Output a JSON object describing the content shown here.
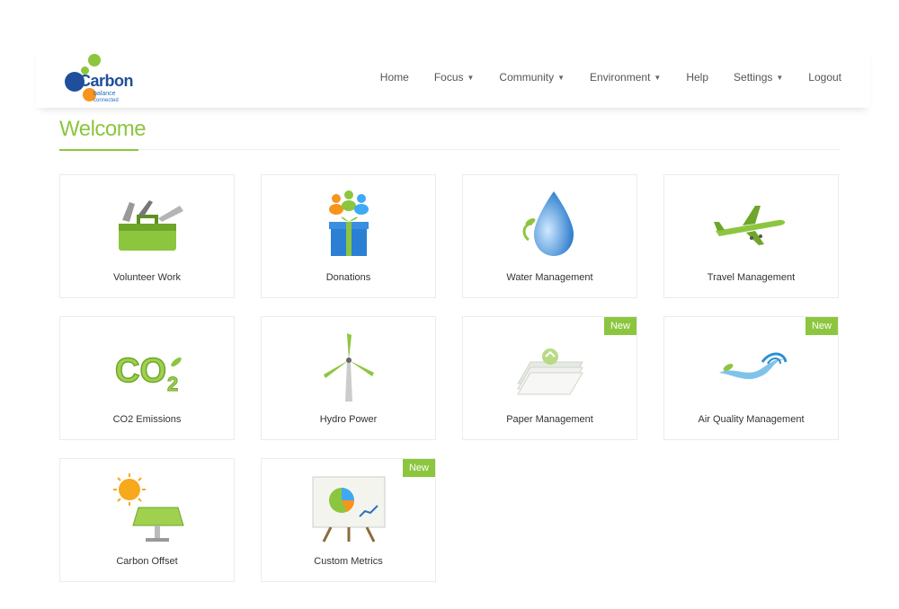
{
  "logo": {
    "word": "Carbon",
    "line1": "balance",
    "line2": "connected"
  },
  "nav": [
    {
      "label": "Home",
      "dropdown": false
    },
    {
      "label": "Focus",
      "dropdown": true
    },
    {
      "label": "Community",
      "dropdown": true
    },
    {
      "label": "Environment",
      "dropdown": true
    },
    {
      "label": "Help",
      "dropdown": false
    },
    {
      "label": "Settings",
      "dropdown": true
    },
    {
      "label": "Logout",
      "dropdown": false
    }
  ],
  "page_title": "Welcome",
  "tiles": [
    {
      "label": "Volunteer Work",
      "icon": "toolbox-icon",
      "badge": ""
    },
    {
      "label": "Donations",
      "icon": "gift-people-icon",
      "badge": ""
    },
    {
      "label": "Water Management",
      "icon": "water-drop-icon",
      "badge": ""
    },
    {
      "label": "Travel Management",
      "icon": "airplane-icon",
      "badge": ""
    },
    {
      "label": "CO2 Emissions",
      "icon": "co2-icon",
      "badge": ""
    },
    {
      "label": "Hydro Power",
      "icon": "wind-turbine-icon",
      "badge": ""
    },
    {
      "label": "Paper Management",
      "icon": "recycled-paper-icon",
      "badge": "New"
    },
    {
      "label": "Air Quality Management",
      "icon": "air-wave-icon",
      "badge": "New"
    },
    {
      "label": "Carbon Offset",
      "icon": "solar-panel-icon",
      "badge": ""
    },
    {
      "label": "Custom Metrics",
      "icon": "chart-easel-icon",
      "badge": "New"
    }
  ],
  "colors": {
    "accent": "#8cc63f",
    "brand_blue": "#1f4e9c",
    "brand_orange": "#f7941d"
  }
}
